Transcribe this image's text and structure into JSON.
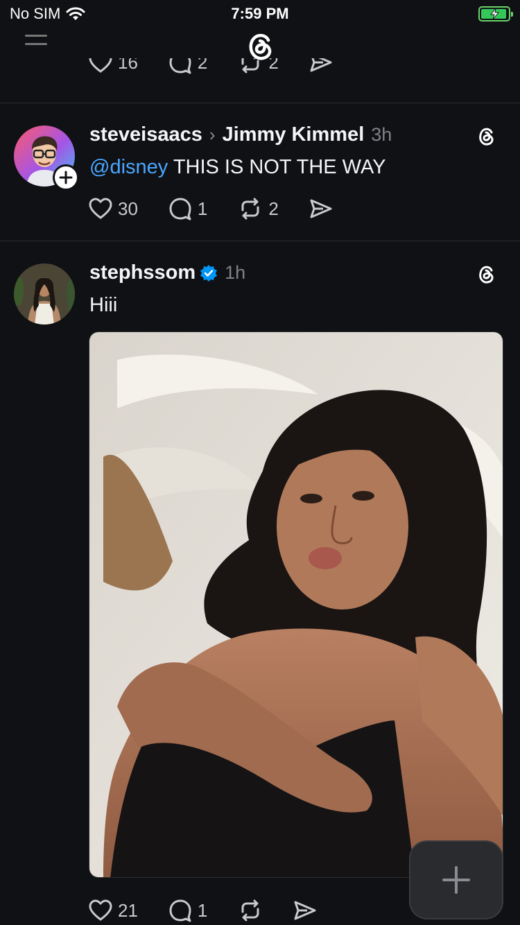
{
  "status_bar": {
    "carrier": "No SIM",
    "time": "7:59 PM"
  },
  "prev_post": {
    "likes": "16",
    "replies": "2",
    "reposts": "2"
  },
  "posts": [
    {
      "username": "steveisaacs",
      "reply_to": "Jimmy Kimmel",
      "time": "3h",
      "mention": "@disney",
      "text": " THIS IS NOT THE WAY",
      "likes": "30",
      "replies": "1",
      "reposts": "2"
    },
    {
      "username": "stephssom",
      "verified": true,
      "time": "1h",
      "text": "Hiii",
      "likes": "21",
      "replies": "1"
    }
  ],
  "colors": {
    "background": "#101114",
    "mention": "#4ba6ff",
    "verified": "#0095f6",
    "battery": "#34c759"
  },
  "icons": [
    "menu-icon",
    "threads-logo-icon",
    "heart-icon",
    "comment-icon",
    "repost-icon",
    "share-icon",
    "plus-icon",
    "verified-badge-icon"
  ]
}
